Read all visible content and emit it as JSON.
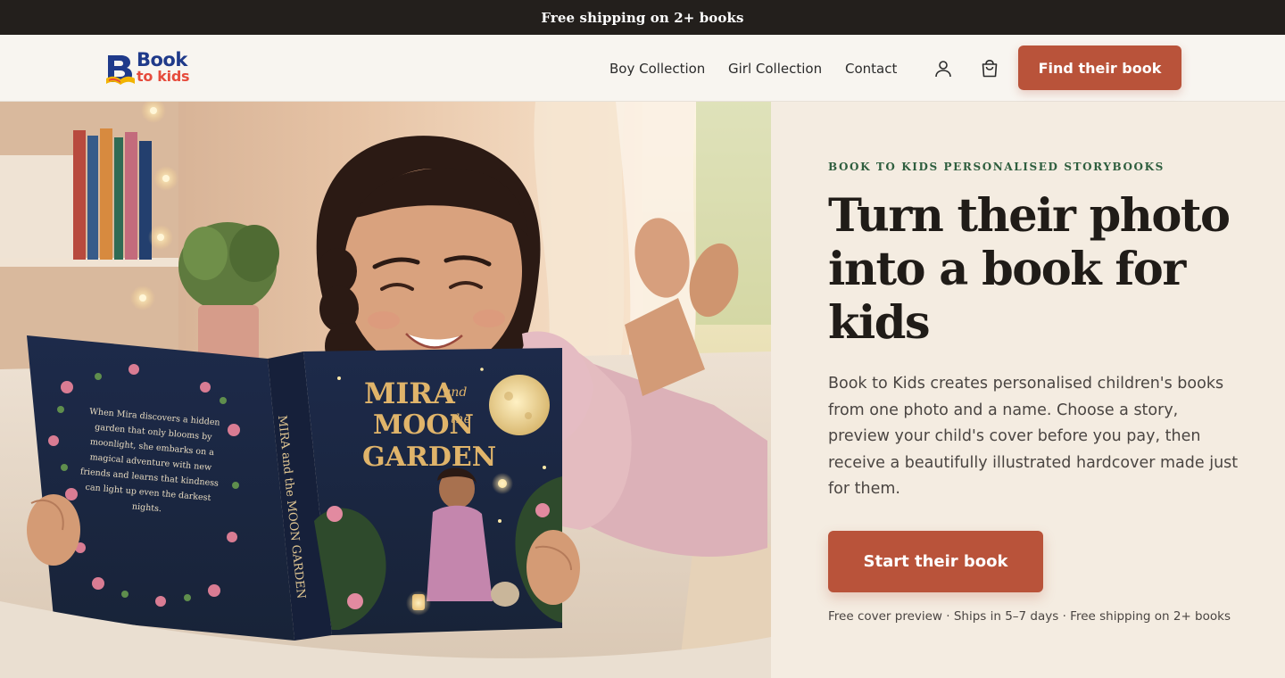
{
  "announcement": "Free shipping on 2+ books",
  "brand": {
    "line1": "Book",
    "line2": "to kids"
  },
  "nav": {
    "links": [
      "Boy Collection",
      "Girl Collection",
      "Contact"
    ],
    "account_icon": "user-icon",
    "cart_icon": "shopping-bag-icon",
    "cta": "Find their book"
  },
  "hero": {
    "image_alt": "Girl lying on a bed reading a personalised storybook",
    "book": {
      "cover_title_1": "MIRA",
      "cover_title_and": "and",
      "cover_title_2": "MOON",
      "cover_title_the": "the",
      "cover_title_3": "GARDEN",
      "spine": "MIRA and the MOON GARDEN",
      "back_text": "When Mira discovers a hidden garden that only blooms by moonlight, she embarks on a magical adventure with new friends and learns that kindness can light up even the darkest nights."
    },
    "eyebrow": "BOOK TO KIDS PERSONALISED STORYBOOKS",
    "headline": "Turn their photo into a book for kids",
    "body": "Book to Kids creates personalised children's books from one photo and a name. Choose a story, preview your child's cover before you pay, then receive a beautifully illustrated hardcover made just for them.",
    "cta": "Start their book",
    "fineprint": "Free cover preview · Ships in 5–7 days · Free shipping on 2+ books"
  },
  "colors": {
    "accent": "#b9533a",
    "dark": "#231f1c",
    "eyebrow": "#2e5e3e",
    "panel": "#f4ece1",
    "brand_blue": "#1f3a8a",
    "brand_red": "#e64b3c"
  }
}
